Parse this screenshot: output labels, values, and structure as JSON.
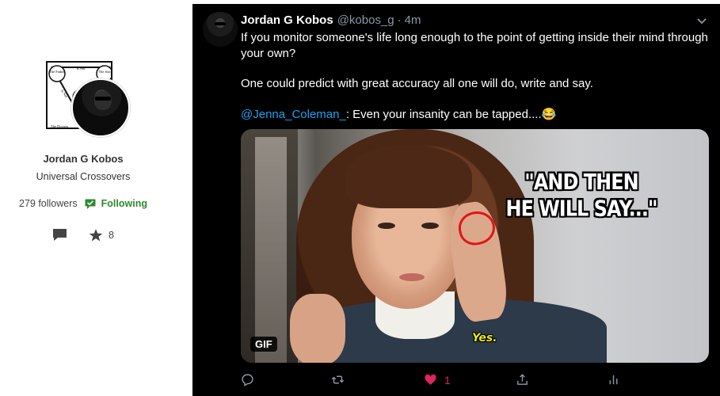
{
  "profile": {
    "name": "Jordan G Kobos",
    "group": "Universal Crossovers",
    "followers": "279 followers",
    "following_label": "Following",
    "star_count": "8",
    "logo_texts": {
      "father": "The Father",
      "son": "The Son",
      "is_not": "Is Not",
      "is_not_left": "Is Not",
      "doctrine": "The Doctrin"
    }
  },
  "tweet": {
    "author_name": "Jordan G Kobos",
    "handle": "@kobos_g",
    "separator": "·",
    "time": "4m",
    "paragraph1": "If you monitor someone's life long enough to the point of getting inside their mind through your own?",
    "paragraph2": "One could predict with great accuracy all one will do, write and say.",
    "mention": "@Jenna_Coleman_",
    "paragraph3_rest": ": Even your insanity can be tapped....😂",
    "media": {
      "caption_line1": "\"AND THEN",
      "caption_line2": "HE WILL SAY...\"",
      "subtitle": "Yes.",
      "badge": "GIF"
    },
    "actions": {
      "like_count": "1"
    }
  },
  "colors": {
    "accent_blue": "#1da1f2",
    "like_red": "#e0245e",
    "following_green": "#2e8b2e",
    "muted_gray": "#8899a6"
  },
  "icons": [
    "comment-icon",
    "star-icon",
    "following-icon",
    "chevron-down-icon",
    "reply-icon",
    "retweet-icon",
    "heart-icon",
    "share-icon",
    "analytics-icon"
  ]
}
